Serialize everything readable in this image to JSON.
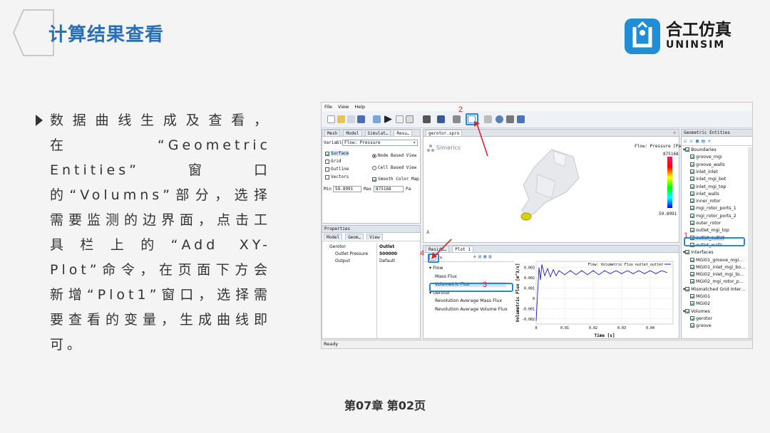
{
  "slide": {
    "title": "计算结果查看",
    "logo_cn": "合工仿真",
    "logo_en": "UNINSIM",
    "bullet_text": "数据曲线生成及查看，在“Geometric Entities”窗口的“Volumns”部分，选择需要监测的边界面，点击工具栏上的“Add XY-Plot”命令，在页面下方会新增“Plot1”窗口，选择需要查看的变量，生成曲线即可。",
    "footer": "第07章  第02页"
  },
  "colors": {
    "accent": "#2a6fb6",
    "highlight": "#2c86d6",
    "annotation": "#e0242a",
    "brand": "#1f8ed6"
  },
  "app": {
    "menu": [
      "File",
      "View",
      "Help"
    ],
    "annotations": [
      "1",
      "2",
      "3",
      "4"
    ],
    "left_tabs": [
      "Mesh",
      "Model",
      "Simulat…",
      "Resu…"
    ],
    "variable_label": "Variable",
    "variable_value": "Flow: Pressure",
    "options": {
      "surface": "Surface",
      "grid": "Grid",
      "outline": "Outline",
      "vectors": "Vectors",
      "node_based": "Node Based View",
      "cell_based": "Cell Based View",
      "smooth": "Smooth Color Map"
    },
    "min_label": "Min",
    "min_value": "59.8991",
    "max_label": "Max",
    "max_value": "875168",
    "unit": "Pa",
    "properties_title": "Properties",
    "prop_tabs": [
      "Model",
      "Geom…",
      "View"
    ],
    "prop_rows": [
      {
        "name": "Gerotor",
        "value": "Outlet"
      },
      {
        "name": "Outlet Pressure",
        "value": "500000"
      },
      {
        "name": "Output",
        "value": "Default"
      }
    ],
    "viewport_tab": "gerotor.spro",
    "brand_label": "Simerics",
    "colorbar": {
      "title": "Flow: Pressure [Pa]",
      "max": "875168",
      "min": "59.8991"
    },
    "bottom_tabs": [
      "Residu…",
      "Plot 1"
    ],
    "flow_tree": [
      {
        "label": "Flow",
        "level": 0
      },
      {
        "label": "Mass Flux",
        "level": 1
      },
      {
        "label": "Volumetric Flux",
        "level": 1,
        "selected": true
      },
      {
        "label": "Gerotor",
        "level": 0
      },
      {
        "label": "Revolution Average Mass Flux",
        "level": 1
      },
      {
        "label": "Revolution Average Volume Flux",
        "level": 1
      }
    ],
    "geo_title": "Geometric Entities",
    "geo_tree": [
      {
        "label": "Boundaries",
        "level": 0
      },
      {
        "label": "groove_mgi",
        "level": 1
      },
      {
        "label": "groove_walls",
        "level": 1
      },
      {
        "label": "inlet_inlet",
        "level": 1
      },
      {
        "label": "inlet_mgi_bot",
        "level": 1
      },
      {
        "label": "inlet_mgi_top",
        "level": 1
      },
      {
        "label": "inlet_walls",
        "level": 1
      },
      {
        "label": "inner_rotor",
        "level": 1
      },
      {
        "label": "mgi_rotor_ports_1",
        "level": 1
      },
      {
        "label": "mgi_rotor_ports_2",
        "level": 1
      },
      {
        "label": "outer_rotor",
        "level": 1
      },
      {
        "label": "outlet_mgi_top",
        "level": 1
      },
      {
        "label": "outlet_outlet",
        "level": 1,
        "selected": true
      },
      {
        "label": "outlet_walls",
        "level": 1
      },
      {
        "label": "Interfaces",
        "level": 0
      },
      {
        "label": "MGI01_groove_mgi…",
        "level": 1
      },
      {
        "label": "MGI01_inlet_mgi_bo…",
        "level": 1
      },
      {
        "label": "MGI02_inlet_mgi_to…",
        "level": 1
      },
      {
        "label": "MGI02_mgi_rotor_p…",
        "level": 1
      },
      {
        "label": "Mismatched Grid Inter…",
        "level": 0
      },
      {
        "label": "MGI01",
        "level": 1
      },
      {
        "label": "MGI02",
        "level": 1
      },
      {
        "label": "Volumes",
        "level": 0
      },
      {
        "label": "gerotor",
        "level": 1
      },
      {
        "label": "groove",
        "level": 1
      }
    ],
    "status": "Ready"
  },
  "chart_data": {
    "type": "line",
    "legend": "Flow: Volumetric Flux outlet_outlet",
    "xlabel": "Time [s]",
    "ylabel": "Volumetric Flux [m^3/s]",
    "xticks": [
      "0",
      "0.01",
      "0.02",
      "0.03",
      "0.04"
    ],
    "yticks": [
      "0.003",
      "0.002",
      "0.001",
      "0",
      "-0.001",
      "-0.002"
    ],
    "xlim": [
      0,
      0.048
    ],
    "ylim": [
      -0.0025,
      0.0036
    ],
    "series": [
      {
        "name": "Flow: Volumetric Flux outlet_outlet",
        "x": [
          0,
          0.0005,
          0.001,
          0.0015,
          0.002,
          0.003,
          0.004,
          0.005,
          0.006,
          0.007,
          0.008,
          0.01,
          0.012,
          0.014,
          0.016,
          0.018,
          0.02,
          0.022,
          0.024,
          0.026,
          0.028,
          0.03,
          0.032,
          0.034,
          0.036,
          0.038,
          0.04,
          0.042,
          0.044,
          0.046
        ],
        "y": [
          -0.0022,
          0.0005,
          0.003,
          0.0018,
          0.0033,
          0.0022,
          0.0029,
          0.0021,
          0.0028,
          0.0022,
          0.0027,
          0.0023,
          0.0027,
          0.0023,
          0.0027,
          0.0023,
          0.0027,
          0.0023,
          0.0027,
          0.0024,
          0.0027,
          0.0024,
          0.0027,
          0.0024,
          0.0027,
          0.0024,
          0.0027,
          0.0024,
          0.0027,
          0.0025
        ]
      }
    ]
  }
}
